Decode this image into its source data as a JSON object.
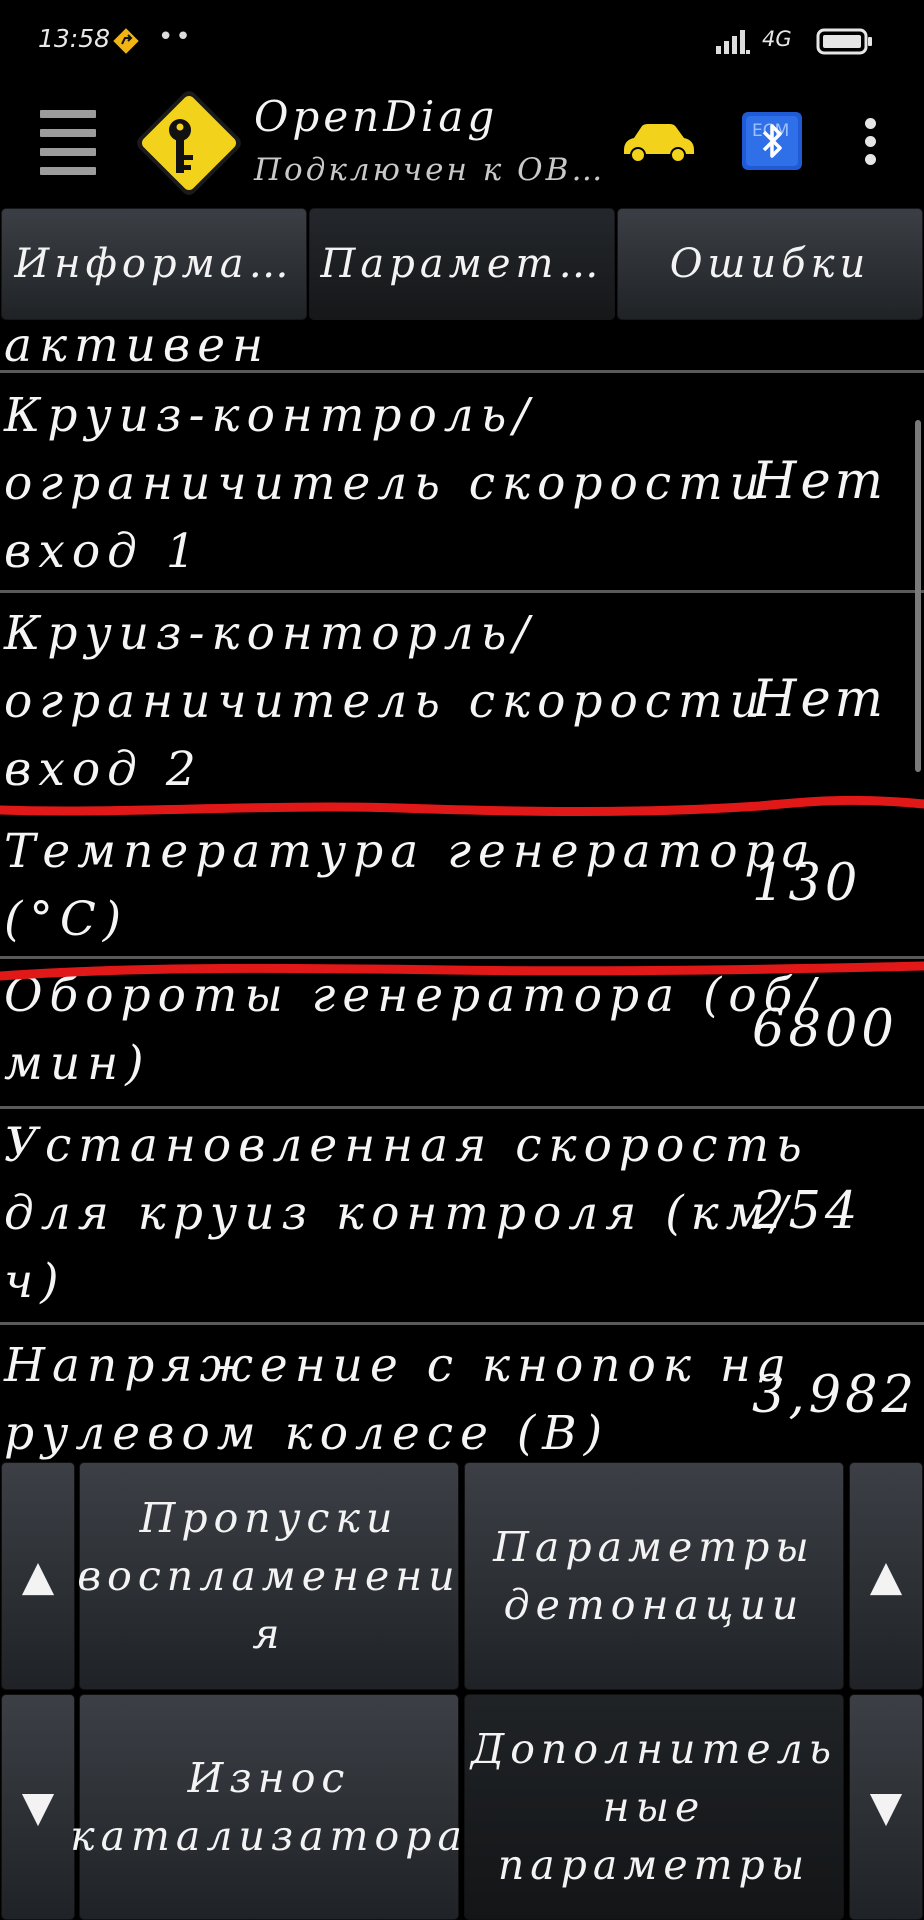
{
  "status_bar": {
    "time": "13:58",
    "dots": "••",
    "network": "4G",
    "icons": [
      "gps-navigation-icon",
      "signal-icon",
      "battery-icon"
    ]
  },
  "app_bar": {
    "title": "OpenDiag",
    "subtitle": "Подключен к ОВ…",
    "icons": [
      "menu-icon",
      "app-logo-key-icon",
      "car-icon",
      "bluetooth-ecm-icon",
      "more-options-icon"
    ]
  },
  "tabs": [
    {
      "label": "Информа…",
      "active": false
    },
    {
      "label": "Парамет…",
      "active": true
    },
    {
      "label": "Ошибки",
      "active": false
    }
  ],
  "parameters": [
    {
      "lines": [
        "активен"
      ],
      "value": ""
    },
    {
      "lines": [
        "Круиз-контроль/",
        "ограничитель скорости",
        "вход 1"
      ],
      "value": "Нет"
    },
    {
      "lines": [
        "Круиз-конторль/",
        "ограничитель скорости",
        "вход 2"
      ],
      "value": "Нет"
    },
    {
      "lines": [
        "Температура генератора",
        "(°C)"
      ],
      "value": "130"
    },
    {
      "lines": [
        "Обороты генератора (об/",
        "мин)"
      ],
      "value": "6800"
    },
    {
      "lines": [
        "Установленная скорость",
        "для круиз контроля (км/",
        "ч)"
      ],
      "value": "254"
    },
    {
      "lines": [
        "Напряжение с кнопок на",
        "рулевом колесе (В)"
      ],
      "value": "3,982"
    }
  ],
  "bottom_buttons": {
    "up_arrow": "▲",
    "down_arrow": "▼",
    "misfires": [
      "Пропуски",
      "воспламенени",
      "я"
    ],
    "knock": [
      "Параметры",
      "детонации"
    ],
    "catalyst": [
      "Износ",
      "катализатора"
    ],
    "additional": [
      "Дополнитель",
      "ные",
      "параметры"
    ]
  },
  "colors": {
    "background": "#000000",
    "button_top": "#3c4046",
    "button_bottom": "#1f2226",
    "highlight_marker": "#e01818",
    "logo_yellow": "#f2d21b",
    "car_yellow": "#f2d21b",
    "bluetooth_blue": "#1f5bd6"
  }
}
